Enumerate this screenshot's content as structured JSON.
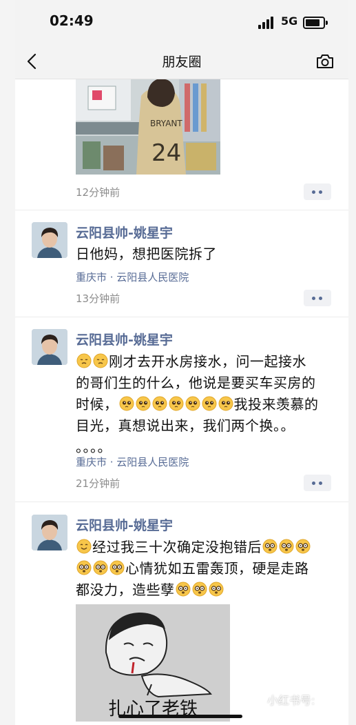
{
  "status_bar": {
    "time": "02:49",
    "network": "5G",
    "battery_level": 0.85
  },
  "nav": {
    "title": "朋友圈",
    "back_icon": "chevron-left-icon",
    "camera_icon": "camera-icon"
  },
  "posts": [
    {
      "time": "12分钟前",
      "image": "photo-girl-jersey-24"
    },
    {
      "author": "云阳县帅-姚星宇",
      "text": "日他妈，想把医院拆了",
      "location": "重庆市 · 云阳县人民医院",
      "time": "13分钟前"
    },
    {
      "author": "云阳县帅-姚星宇",
      "lines": [
        "刚才去开水房接水，问一起接水",
        "的哥们生的什么，他说是要买车买房的",
        "时候，",
        "我投来羡慕的",
        "目光，真想说出来，我们两个换。。",
        "。。。。"
      ],
      "location": "重庆市 · 云阳县人民医院",
      "time": "21分钟前"
    },
    {
      "author": "云阳县帅-姚星宇",
      "lines": [
        "经过我三十次确定没抱错后",
        "心情犹如五雷轰顶，硬是走路",
        "都没力，造些孽"
      ],
      "sticker_caption": "扎心了老铁"
    }
  ],
  "watermark": "小红书号:"
}
